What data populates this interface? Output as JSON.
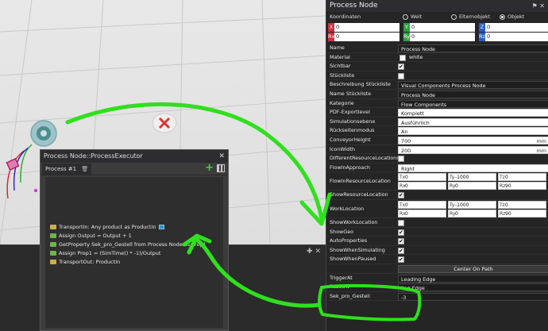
{
  "process_window": {
    "title": "Process Node::ProcessExecutor",
    "close": "✕",
    "tab_label": "Process #1",
    "add": "+",
    "statements": [
      {
        "text": "TransportIn: Any product as ProductIn",
        "icon": "transport-in-icon"
      },
      {
        "text": "Assign Output = Output + 1",
        "icon": "assign-icon"
      },
      {
        "text": "GetProperty Sek_pro_Gestell from Process Node as Prop1",
        "icon": "get-property-icon"
      },
      {
        "text": "Assign Prop1 = (SimTime() * -1)/Output",
        "icon": "assign-icon"
      },
      {
        "text": "TransportOut: ProductIn",
        "icon": "transport-out-icon"
      }
    ]
  },
  "dock": {
    "tools": "✚  ✕"
  },
  "properties": {
    "title": "Process Node",
    "coord_label": "Koordinaten",
    "coord_options": [
      "Welt",
      "Elternobjekt",
      "Objekt"
    ],
    "coord_selected": "Objekt",
    "xyz_pos": [
      {
        "axis": "X",
        "value": "0"
      },
      {
        "axis": "Y",
        "value": "0"
      },
      {
        "axis": "Z",
        "value": "0"
      }
    ],
    "xyz_rot": [
      {
        "axis": "Rx",
        "value": "0"
      },
      {
        "axis": "Ry",
        "value": "0"
      },
      {
        "axis": "Rz",
        "value": "0"
      }
    ],
    "rows": [
      {
        "label": "Name",
        "type": "text",
        "value": "Process Node"
      },
      {
        "label": "Material",
        "type": "material",
        "value": "white"
      },
      {
        "label": "Sichtbar",
        "type": "check",
        "checked": true
      },
      {
        "label": "Stückliste",
        "type": "check",
        "checked": false
      },
      {
        "label": "Beschreibung Stückliste",
        "type": "text",
        "value": "Visual Components Process Node"
      },
      {
        "label": "Name Stückliste",
        "type": "text",
        "value": "Process Node"
      },
      {
        "label": "Kategorie",
        "type": "text",
        "value": "Flow Components"
      },
      {
        "label": "PDF-Exportlevel",
        "type": "white",
        "value": "Komplett"
      },
      {
        "label": "Simulationsebene",
        "type": "white",
        "value": "Ausführlich"
      },
      {
        "label": "Rückseitenmodus",
        "type": "white",
        "value": "An"
      },
      {
        "label": "ConveyorHeight",
        "type": "unit",
        "value": "700",
        "unit": "mm"
      },
      {
        "label": "IconWidth",
        "type": "unit",
        "value": "200",
        "unit": "mm"
      },
      {
        "label": "DifferentResourceLocations",
        "type": "check",
        "checked": false
      },
      {
        "label": "FlowInApproach",
        "type": "white",
        "value": "Right"
      },
      {
        "label": "FlowInResourceLocation",
        "type": "triple2",
        "a": [
          {
            "k": "Tx",
            "v": "0"
          },
          {
            "k": "Ty",
            "v": "-1000"
          },
          {
            "k": "Tz",
            "v": "0"
          }
        ],
        "b": [
          {
            "k": "Rx",
            "v": "0"
          },
          {
            "k": "Ry",
            "v": "0"
          },
          {
            "k": "Rz",
            "v": "90"
          }
        ]
      },
      {
        "label": "ShowResourceLocation",
        "type": "check",
        "checked": true
      },
      {
        "label": "WorkLocation",
        "type": "triple2",
        "a": [
          {
            "k": "Tx",
            "v": "0"
          },
          {
            "k": "Ty",
            "v": "-1000"
          },
          {
            "k": "Tz",
            "v": "0"
          }
        ],
        "b": [
          {
            "k": "Rx",
            "v": "0"
          },
          {
            "k": "Ry",
            "v": "0"
          },
          {
            "k": "Rz",
            "v": "90"
          }
        ]
      },
      {
        "label": "ShowWorkLocation",
        "type": "check",
        "checked": false
      },
      {
        "label": "ShowGeo",
        "type": "check",
        "checked": true
      },
      {
        "label": "AutoProperties",
        "type": "check",
        "checked": true
      },
      {
        "label": "ShowWhenSimulating",
        "type": "check",
        "checked": true
      },
      {
        "label": "ShowWhenPaused",
        "type": "check",
        "checked": true
      },
      {
        "label": "",
        "type": "button",
        "value": "Center On Path"
      },
      {
        "label": "TriggerAt",
        "type": "text",
        "value": "Leading Edge"
      },
      {
        "label": "ResetAt",
        "type": "text",
        "value": "ling Edge"
      },
      {
        "label": "Sek_pro_Gestell",
        "type": "text",
        "value": "-3"
      }
    ]
  }
}
